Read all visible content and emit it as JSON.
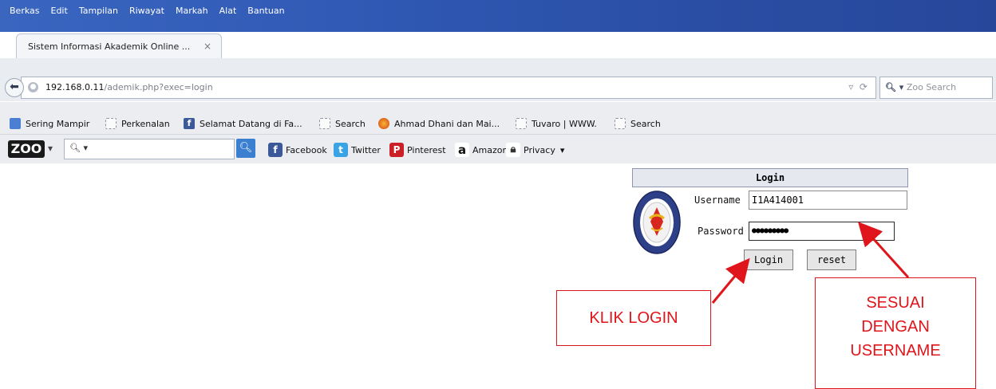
{
  "menu": [
    "Berkas",
    "Edit",
    "Tampilan",
    "Riwayat",
    "Markah",
    "Alat",
    "Bantuan"
  ],
  "tab": {
    "title": "Sistem Informasi Akademik Online ...",
    "close": "×",
    "new": "+"
  },
  "url": {
    "host": "192.168.0.11",
    "path": "/ademik.php?exec=login"
  },
  "search": {
    "placeholder": "Zoo Search"
  },
  "bookmarks": [
    "Sering Mampir",
    "Perkenalan",
    "Selamat Datang di Fa...",
    "Search",
    "Ahmad Dhani dan Mai...",
    "Tuvaro | WWW.",
    "Search"
  ],
  "zoo_toolbar": {
    "logo": "ZOO",
    "items": [
      "Facebook",
      "Twitter",
      "Pinterest",
      "Amazon",
      "Privacy"
    ]
  },
  "login": {
    "header": "Login",
    "username_label": "Username",
    "username_value": "I1A414001",
    "password_label": "Password",
    "password_value": "●●●●●●●●●",
    "login_button": "Login",
    "reset_button": "reset"
  },
  "annotations": {
    "klik": "KLIK  LOGIN",
    "sesuai": [
      "SESUAI",
      "DENGAN",
      "USERNAME"
    ]
  },
  "colors": {
    "annotation": "#e0151b",
    "menubar": "#2f58b3"
  }
}
